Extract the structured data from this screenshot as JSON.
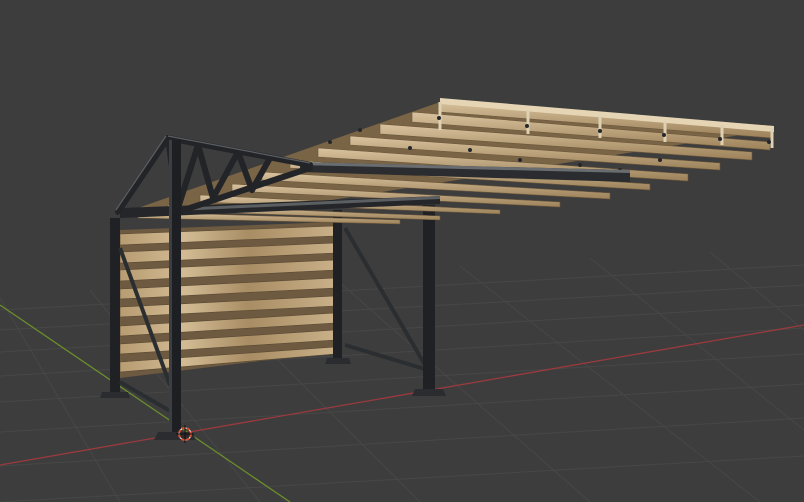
{
  "viewport": {
    "background_color": "#3d3d3d",
    "grid_color": "#4a4a4a",
    "x_axis_color": "#9b3a3e",
    "y_axis_color": "#6a8f2c"
  },
  "scene": {
    "object": "pergola-carport",
    "frame_color": "#1f2124",
    "wood_light_color": "#c8b08a",
    "wood_dark_color": "#8c7352",
    "origin_marker_color": "#e04a2a"
  },
  "icons": {
    "origin": "3d-cursor-icon"
  }
}
